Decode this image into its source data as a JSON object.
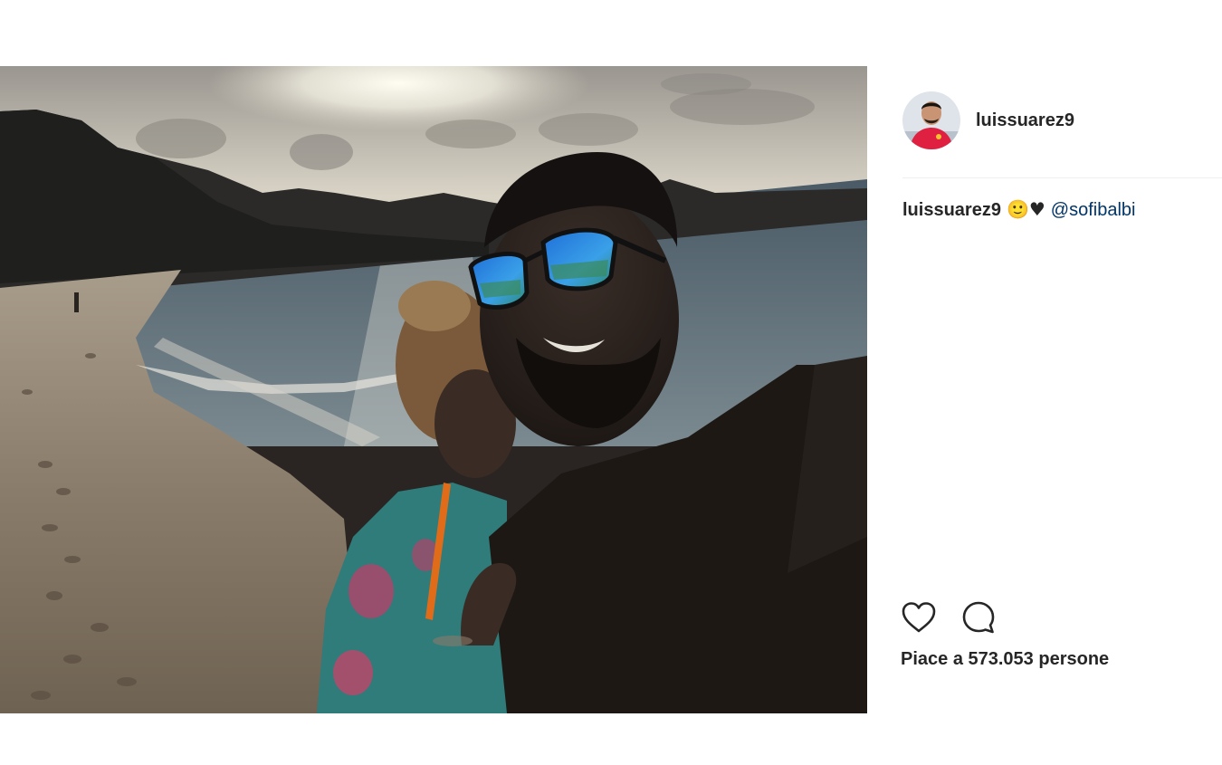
{
  "post": {
    "image": {
      "description_icon": "beach-selfie-photo"
    },
    "author": {
      "username": "luissuarez9",
      "avatar_icon": "profile-avatar"
    },
    "caption": {
      "username": "luissuarez9",
      "emoji": "🙂♥",
      "mention": "@sofibalbi"
    },
    "actions": {
      "like_icon": "heart-icon",
      "comment_icon": "comment-icon"
    },
    "likes": {
      "text": "Piace a 573.053 persone"
    }
  },
  "colors": {
    "text": "#262626",
    "mention": "#003569",
    "divider": "#efefef",
    "background": "#ffffff"
  }
}
